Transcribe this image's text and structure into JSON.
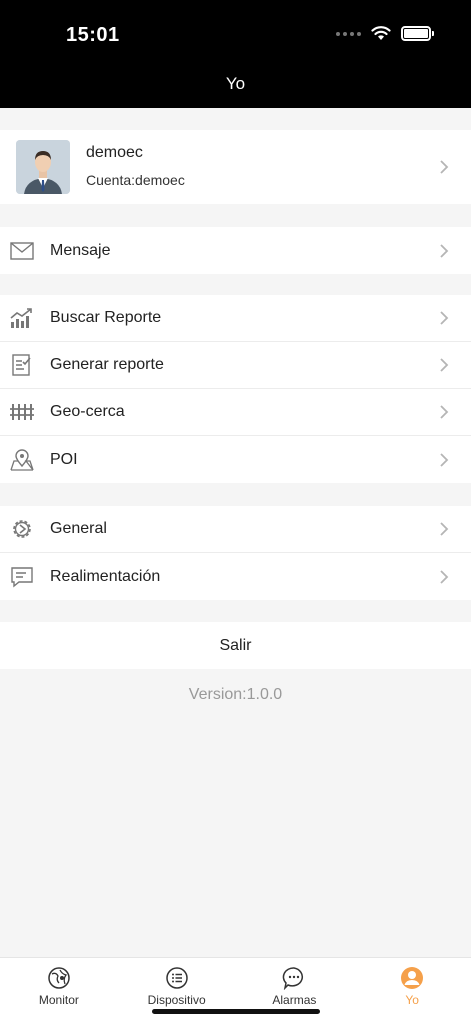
{
  "status": {
    "time": "15:01"
  },
  "nav": {
    "title": "Yo"
  },
  "profile": {
    "username": "demoec",
    "account": "Cuenta:demoec"
  },
  "menu": {
    "message": "Mensaje",
    "search_report": "Buscar Reporte",
    "generate_report": "Generar reporte",
    "geofence": "Geo-cerca",
    "poi": "POI",
    "general": "General",
    "feedback": "Realimentación"
  },
  "logout_label": "Salir",
  "version": "Version:1.0.0",
  "tabs": [
    {
      "label": "Monitor",
      "icon": "globe-icon"
    },
    {
      "label": "Dispositivo",
      "icon": "list-icon"
    },
    {
      "label": "Alarmas",
      "icon": "chat-icon"
    },
    {
      "label": "Yo",
      "icon": "person-icon"
    }
  ],
  "colors": {
    "accent": "#f5a04a",
    "icon_gray": "#777777"
  }
}
